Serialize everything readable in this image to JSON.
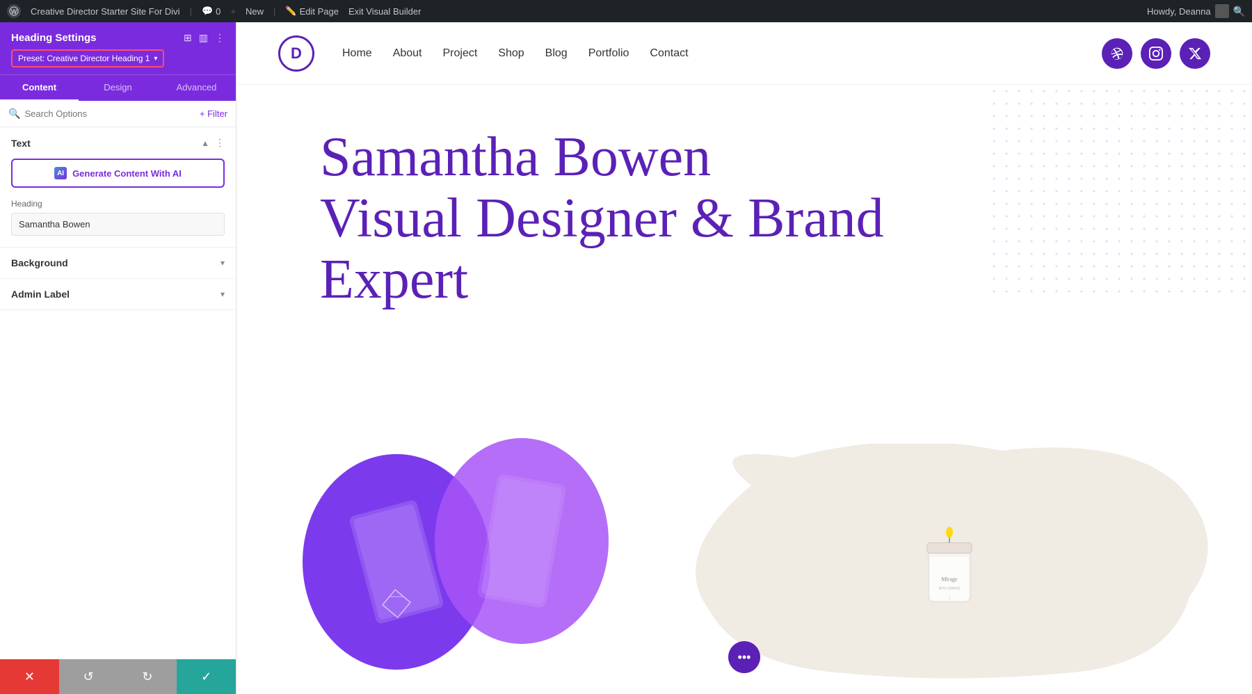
{
  "admin_bar": {
    "wp_logo": "W",
    "site_name": "Creative Director Starter Site For Divi",
    "comments_label": "0",
    "new_label": "New",
    "edit_page_label": "Edit Page",
    "exit_vb_label": "Exit Visual Builder",
    "howdy_label": "Howdy, Deanna"
  },
  "panel": {
    "title": "Heading Settings",
    "preset_label": "Preset: Creative Director Heading 1",
    "tabs": [
      {
        "id": "content",
        "label": "Content",
        "active": true
      },
      {
        "id": "design",
        "label": "Design",
        "active": false
      },
      {
        "id": "advanced",
        "label": "Advanced",
        "active": false
      }
    ],
    "search_placeholder": "Search Options",
    "filter_label": "+ Filter",
    "sections": {
      "text": {
        "title": "Text",
        "ai_button_label": "Generate Content With AI",
        "ai_icon_label": "AI",
        "heading_field_label": "Heading",
        "heading_value": "Samantha Bowen"
      },
      "background": {
        "title": "Background"
      },
      "admin_label": {
        "title": "Admin Label"
      }
    }
  },
  "bottom_bar": {
    "cancel_icon": "✕",
    "undo_icon": "↺",
    "redo_icon": "↻",
    "save_icon": "✓"
  },
  "site": {
    "logo_letter": "D",
    "nav_links": [
      "Home",
      "About",
      "Project",
      "Shop",
      "Blog",
      "Portfolio",
      "Contact"
    ],
    "social_icons": [
      "dribbble",
      "instagram",
      "x-twitter"
    ]
  },
  "hero": {
    "heading_line1": "Samantha Bowen",
    "heading_line2": "Visual Designer & Brand",
    "heading_line3": "Expert"
  },
  "floating_btn": {
    "icon": "•••"
  }
}
